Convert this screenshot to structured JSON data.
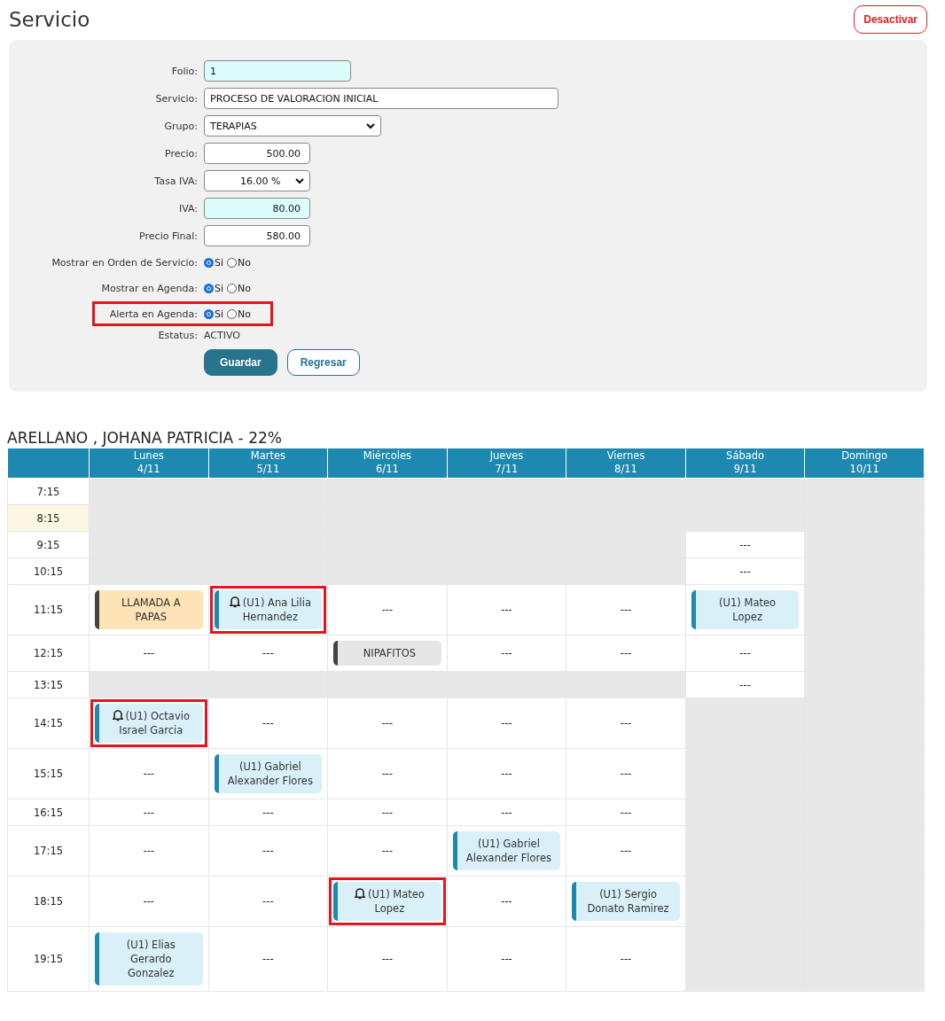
{
  "page_title": "Servicio",
  "deactivate_button": "Desactivar",
  "form": {
    "fields": [
      {
        "label": "Folio:",
        "kind": "text",
        "value": "1",
        "readonly": true
      },
      {
        "label": "Servicio:",
        "kind": "wide",
        "value": "PROCESO DE VALORACION INICIAL",
        "readonly": false
      },
      {
        "label": "Grupo:",
        "kind": "select",
        "value": "TERAPIAS",
        "readonly": false
      },
      {
        "label": "Precio:",
        "kind": "number",
        "value": "500.00",
        "readonly": false
      },
      {
        "label": "Tasa IVA:",
        "kind": "small-select",
        "value": "16.00 %",
        "readonly": false
      },
      {
        "label": "IVA:",
        "kind": "number",
        "value": "80.00",
        "readonly": true
      },
      {
        "label": "Precio Final:",
        "kind": "number",
        "value": "580.00",
        "readonly": false
      }
    ],
    "radios": [
      {
        "label": "Mostrar en Orden de Servicio:",
        "highlighted": false,
        "options": [
          {
            "label": "Si",
            "selected": true
          },
          {
            "label": "No",
            "selected": false
          }
        ]
      },
      {
        "label": "Mostrar en Agenda:",
        "highlighted": false,
        "options": [
          {
            "label": "Si",
            "selected": true
          },
          {
            "label": "No",
            "selected": false
          }
        ]
      },
      {
        "label": "Alerta en Agenda:",
        "highlighted": true,
        "options": [
          {
            "label": "Si",
            "selected": true
          },
          {
            "label": "No",
            "selected": false
          }
        ]
      }
    ],
    "status": {
      "label": "Estatus:",
      "value": "ACTIVO"
    },
    "buttons": [
      {
        "label": "Guardar",
        "kind": "primary"
      },
      {
        "label": "Regresar",
        "kind": "secondary"
      }
    ]
  },
  "schedule": {
    "title": "ARELLANO , JOHANA PATRICIA - 22%",
    "days": [
      {
        "name": "Lunes",
        "date": "4/11"
      },
      {
        "name": "Martes",
        "date": "5/11"
      },
      {
        "name": "Miércoles",
        "date": "6/11"
      },
      {
        "name": "Jueves",
        "date": "7/11"
      },
      {
        "name": "Viernes",
        "date": "8/11"
      },
      {
        "name": "Sábado",
        "date": "9/11"
      },
      {
        "name": "Domingo",
        "date": "10/11"
      }
    ],
    "rows": [
      {
        "time": "7:15",
        "current": false,
        "cells": [
          {
            "kind": "blocked"
          },
          {
            "kind": "blocked"
          },
          {
            "kind": "blocked"
          },
          {
            "kind": "blocked"
          },
          {
            "kind": "blocked"
          },
          {
            "kind": "blocked"
          },
          {
            "kind": "blocked"
          }
        ]
      },
      {
        "time": "8:15",
        "current": true,
        "cells": [
          {
            "kind": "blocked"
          },
          {
            "kind": "blocked"
          },
          {
            "kind": "blocked"
          },
          {
            "kind": "blocked"
          },
          {
            "kind": "blocked"
          },
          {
            "kind": "blocked"
          },
          {
            "kind": "blocked"
          }
        ]
      },
      {
        "time": "9:15",
        "current": false,
        "cells": [
          {
            "kind": "blocked"
          },
          {
            "kind": "blocked"
          },
          {
            "kind": "blocked"
          },
          {
            "kind": "blocked"
          },
          {
            "kind": "blocked"
          },
          {
            "kind": "empty",
            "text": "---"
          },
          {
            "kind": "blocked"
          }
        ]
      },
      {
        "time": "10:15",
        "current": false,
        "cells": [
          {
            "kind": "blocked"
          },
          {
            "kind": "blocked"
          },
          {
            "kind": "blocked"
          },
          {
            "kind": "blocked"
          },
          {
            "kind": "blocked"
          },
          {
            "kind": "empty",
            "text": "---"
          },
          {
            "kind": "blocked"
          }
        ]
      },
      {
        "time": "11:15",
        "current": false,
        "cells": [
          {
            "kind": "note",
            "text": "LLAMADA A PAPAS",
            "color": "#fde3b5",
            "alert": false,
            "highlighted": false
          },
          {
            "kind": "patient",
            "text": "(U1) Ana Lilia Hernandez",
            "color": "#d9f0f8",
            "alert": true,
            "highlighted": true
          },
          {
            "kind": "empty",
            "text": "---"
          },
          {
            "kind": "empty",
            "text": "---"
          },
          {
            "kind": "empty",
            "text": "---"
          },
          {
            "kind": "patient",
            "text": "(U1) Mateo Lopez",
            "color": "#d9f0f8",
            "alert": false,
            "highlighted": false
          },
          {
            "kind": "blocked"
          }
        ]
      },
      {
        "time": "12:15",
        "current": false,
        "cells": [
          {
            "kind": "empty",
            "text": "---"
          },
          {
            "kind": "empty",
            "text": "---"
          },
          {
            "kind": "note",
            "text": "NIPAFITOS",
            "color": "#e6e6e6",
            "alert": false,
            "highlighted": false
          },
          {
            "kind": "empty",
            "text": "---"
          },
          {
            "kind": "empty",
            "text": "---"
          },
          {
            "kind": "empty",
            "text": "---"
          },
          {
            "kind": "blocked"
          }
        ]
      },
      {
        "time": "13:15",
        "current": false,
        "cells": [
          {
            "kind": "blocked"
          },
          {
            "kind": "blocked"
          },
          {
            "kind": "blocked"
          },
          {
            "kind": "blocked"
          },
          {
            "kind": "blocked"
          },
          {
            "kind": "empty",
            "text": "---"
          },
          {
            "kind": "blocked"
          }
        ]
      },
      {
        "time": "14:15",
        "current": false,
        "cells": [
          {
            "kind": "patient",
            "text": "(U1) Octavio Israel Garcia",
            "color": "#d9f0f8",
            "alert": true,
            "highlighted": true
          },
          {
            "kind": "empty",
            "text": "---"
          },
          {
            "kind": "empty",
            "text": "---"
          },
          {
            "kind": "empty",
            "text": "---"
          },
          {
            "kind": "empty",
            "text": "---"
          },
          {
            "kind": "blocked"
          },
          {
            "kind": "blocked"
          }
        ]
      },
      {
        "time": "15:15",
        "current": false,
        "cells": [
          {
            "kind": "empty",
            "text": "---"
          },
          {
            "kind": "patient",
            "text": "(U1) Gabriel Alexander Flores",
            "color": "#d9f0f8",
            "alert": false,
            "highlighted": false
          },
          {
            "kind": "empty",
            "text": "---"
          },
          {
            "kind": "empty",
            "text": "---"
          },
          {
            "kind": "empty",
            "text": "---"
          },
          {
            "kind": "blocked"
          },
          {
            "kind": "blocked"
          }
        ]
      },
      {
        "time": "16:15",
        "current": false,
        "cells": [
          {
            "kind": "empty",
            "text": "---"
          },
          {
            "kind": "empty",
            "text": "---"
          },
          {
            "kind": "empty",
            "text": "---"
          },
          {
            "kind": "empty",
            "text": "---"
          },
          {
            "kind": "empty",
            "text": "---"
          },
          {
            "kind": "blocked"
          },
          {
            "kind": "blocked"
          }
        ]
      },
      {
        "time": "17:15",
        "current": false,
        "cells": [
          {
            "kind": "empty",
            "text": "---"
          },
          {
            "kind": "empty",
            "text": "---"
          },
          {
            "kind": "empty",
            "text": "---"
          },
          {
            "kind": "patient",
            "text": "(U1) Gabriel Alexander Flores",
            "color": "#d9f0f8",
            "alert": false,
            "highlighted": false
          },
          {
            "kind": "empty",
            "text": "---"
          },
          {
            "kind": "blocked"
          },
          {
            "kind": "blocked"
          }
        ]
      },
      {
        "time": "18:15",
        "current": false,
        "cells": [
          {
            "kind": "empty",
            "text": "---"
          },
          {
            "kind": "empty",
            "text": "---"
          },
          {
            "kind": "patient",
            "text": "(U1) Mateo Lopez",
            "color": "#d9f0f8",
            "alert": true,
            "highlighted": true
          },
          {
            "kind": "empty",
            "text": "---"
          },
          {
            "kind": "patient",
            "text": "(U1) Sergio Donato Ramirez",
            "color": "#d9f0f8",
            "alert": false,
            "highlighted": false
          },
          {
            "kind": "blocked"
          },
          {
            "kind": "blocked"
          }
        ]
      },
      {
        "time": "19:15",
        "current": false,
        "cells": [
          {
            "kind": "patient",
            "text": "(U1) Elias Gerardo Gonzalez",
            "color": "#d9f0f8",
            "alert": false,
            "highlighted": false
          },
          {
            "kind": "empty",
            "text": "---"
          },
          {
            "kind": "empty",
            "text": "---"
          },
          {
            "kind": "empty",
            "text": "---"
          },
          {
            "kind": "empty",
            "text": "---"
          },
          {
            "kind": "blocked"
          },
          {
            "kind": "blocked"
          }
        ]
      }
    ]
  }
}
